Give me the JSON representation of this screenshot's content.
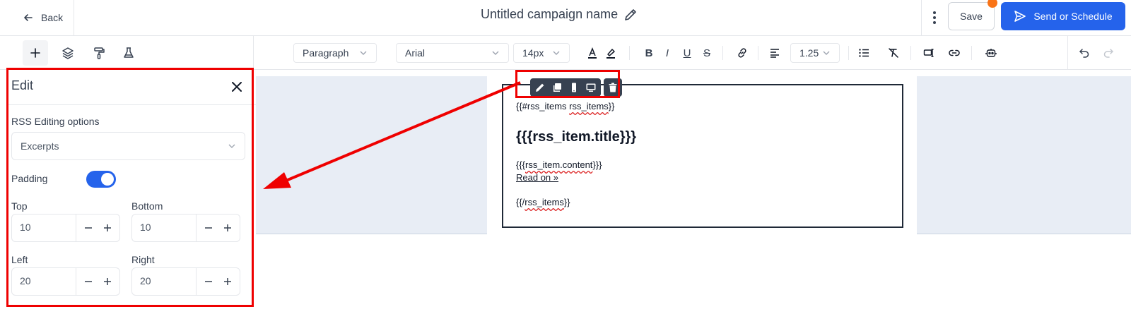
{
  "header": {
    "back_label": "Back",
    "campaign_title": "Untitled campaign name",
    "save_label": "Save",
    "send_label": "Send or Schedule",
    "colors": {
      "primary": "#2563eb",
      "notification": "#f97316"
    }
  },
  "toolbar": {
    "left_tools": [
      "plus-icon",
      "layers-icon",
      "paint-roller-icon",
      "flask-icon"
    ],
    "block_style": "Paragraph",
    "font": "Arial",
    "font_size": "14px",
    "line_height": "1.25"
  },
  "email": {
    "line1_prefix": "{{#rss_items ",
    "line1_var": "rss_items",
    "line1_suffix": "}}",
    "title": "{{{rss_item.title}}}",
    "content_prefix": "{{{",
    "content_var": "rss_item.content",
    "content_suffix": "}}}",
    "read_on": "Read on »",
    "end_prefix": "{{/",
    "end_var": "rss_items",
    "end_suffix": "}}"
  },
  "panel": {
    "title": "Edit",
    "rss_label": "RSS Editing options",
    "rss_value": "Excerpts",
    "padding_label": "Padding",
    "padding_enabled": true,
    "top_label": "Top",
    "top_value": "10",
    "bottom_label": "Bottom",
    "bottom_value": "10",
    "left_label": "Left",
    "left_value": "20",
    "right_label": "Right",
    "right_value": "20"
  },
  "annotation": {
    "color": "#ef0000"
  }
}
